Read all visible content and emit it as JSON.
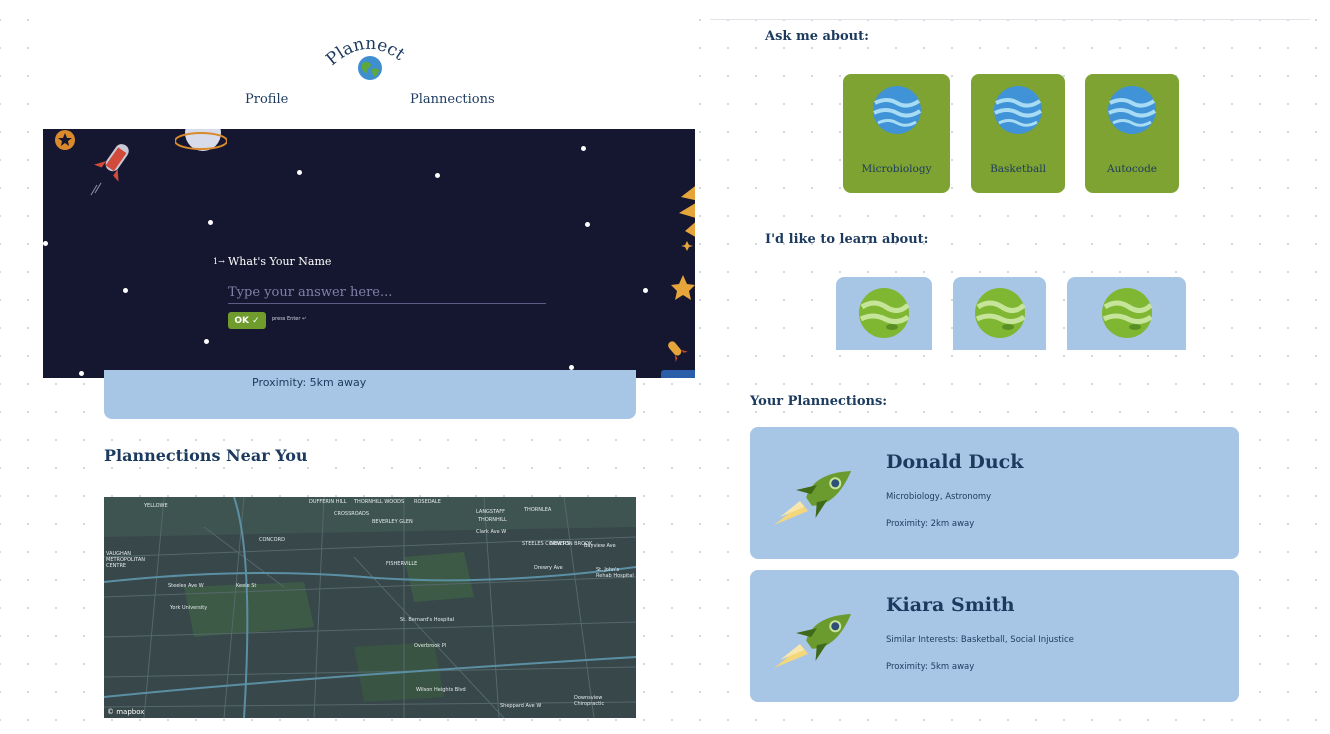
{
  "left": {
    "header": {
      "logo_text": "Plannect",
      "nav": [
        "Profile",
        "Plannections"
      ]
    },
    "question": {
      "number": "1→",
      "label": "What's Your Name",
      "placeholder": "Type your answer here...",
      "ok_label": "OK ✓",
      "hint": "press Enter ↵"
    },
    "proximity_text": "Proximity: 5km away",
    "near_title": "Plannections Near You",
    "map": {
      "attribution": "© mapbox",
      "labels": [
        "YELLOWE",
        "DUFFERIN HILL",
        "THORNHILL WOODS",
        "ROSEDALE",
        "CROSSROADS",
        "BEVERLEY GLEN",
        "LANGSTAFF",
        "THORNHILL",
        "THORNLEA",
        "CONCORD",
        "Clark Ave W",
        "VAUGHAN METROPOLITAN CENTRE",
        "STEELES CORNERS",
        "NEWTON BROOK",
        "Bayview Ave",
        "St. John's Rehab Hospital",
        "FISHERVILLE",
        "Drewry Ave",
        "Steeles Ave W",
        "York University",
        "Keele St",
        "St. Bernard's Hospital",
        "Overbrook Pl",
        "Wilson Heights Blvd",
        "Sheppard Ave W",
        "Downsview Chiropractic"
      ]
    }
  },
  "right": {
    "ask_title": "Ask me about:",
    "ask_topics": [
      "Microbiology",
      "Basketball",
      "Autocode"
    ],
    "learn_title": "I'd like to learn about:",
    "plannections_title": "Your Plannections:",
    "plannections": [
      {
        "name": "Donald Duck",
        "interests": "Microbiology, Astronomy",
        "proximity": "Proximity: 2km away"
      },
      {
        "name": "Kiara Smith",
        "interests": "Similar Interests: Basketball, Social Injustice",
        "proximity": "Proximity: 5km away"
      }
    ]
  },
  "colors": {
    "navy": "#1b3a5e",
    "card_blue": "#a7c6e6",
    "card_green": "#7ea332",
    "space": "#15162f",
    "ok_green": "#6f9c2c"
  }
}
